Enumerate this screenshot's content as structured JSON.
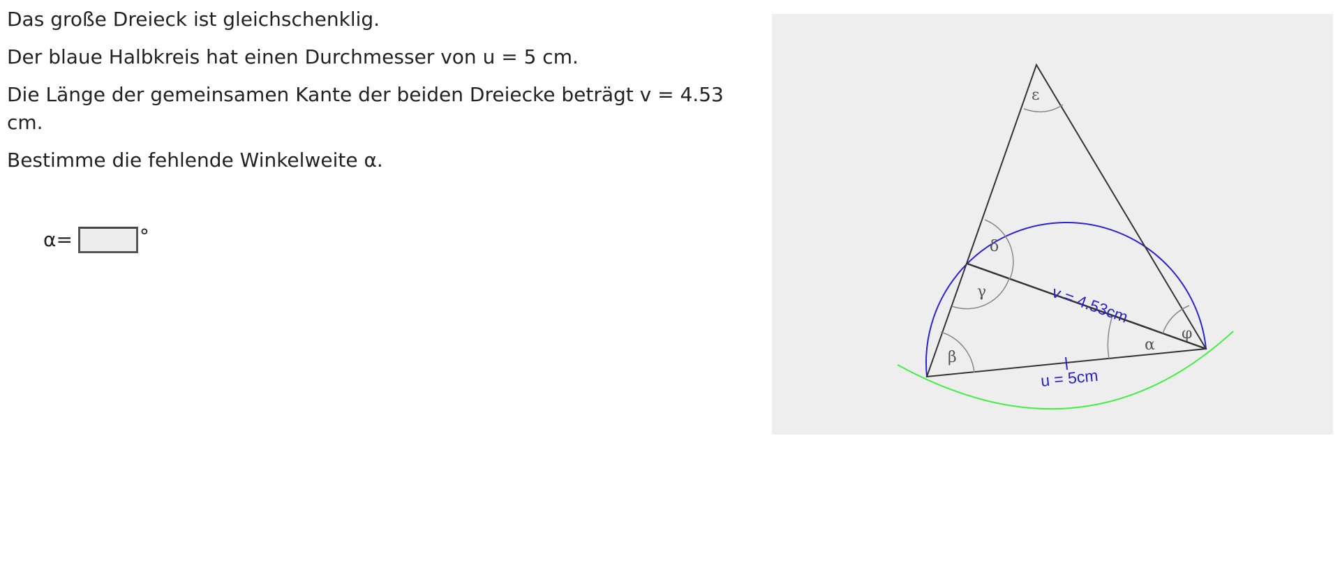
{
  "task": {
    "line1": "Das große Dreieck ist gleichschenklig.",
    "line2": "Der blaue Halbkreis hat einen Durchmesser von u = 5 cm.",
    "line3": "Die Länge der gemeinsamen Kante der beiden Dreiecke beträgt v = 4.53 cm.",
    "line4": "Bestimme die fehlende Winkelweite α."
  },
  "answer": {
    "label": "α=",
    "value": "",
    "unit": "°"
  },
  "figure": {
    "angle_labels": {
      "epsilon": "ε",
      "delta": "δ",
      "gamma": "γ",
      "beta": "β",
      "alpha": "α",
      "phi": "φ"
    },
    "side_v_label": "v = 4.53cm",
    "side_u_label": "u = 5cm",
    "colors": {
      "background": "#eeeeee",
      "triangle": "#333333",
      "semicircle": "#2a22d6",
      "circle_arc": "#44ee44",
      "angle_arcs": "#888888",
      "labels": "#555555",
      "measure_labels": "#2a22c8"
    }
  }
}
